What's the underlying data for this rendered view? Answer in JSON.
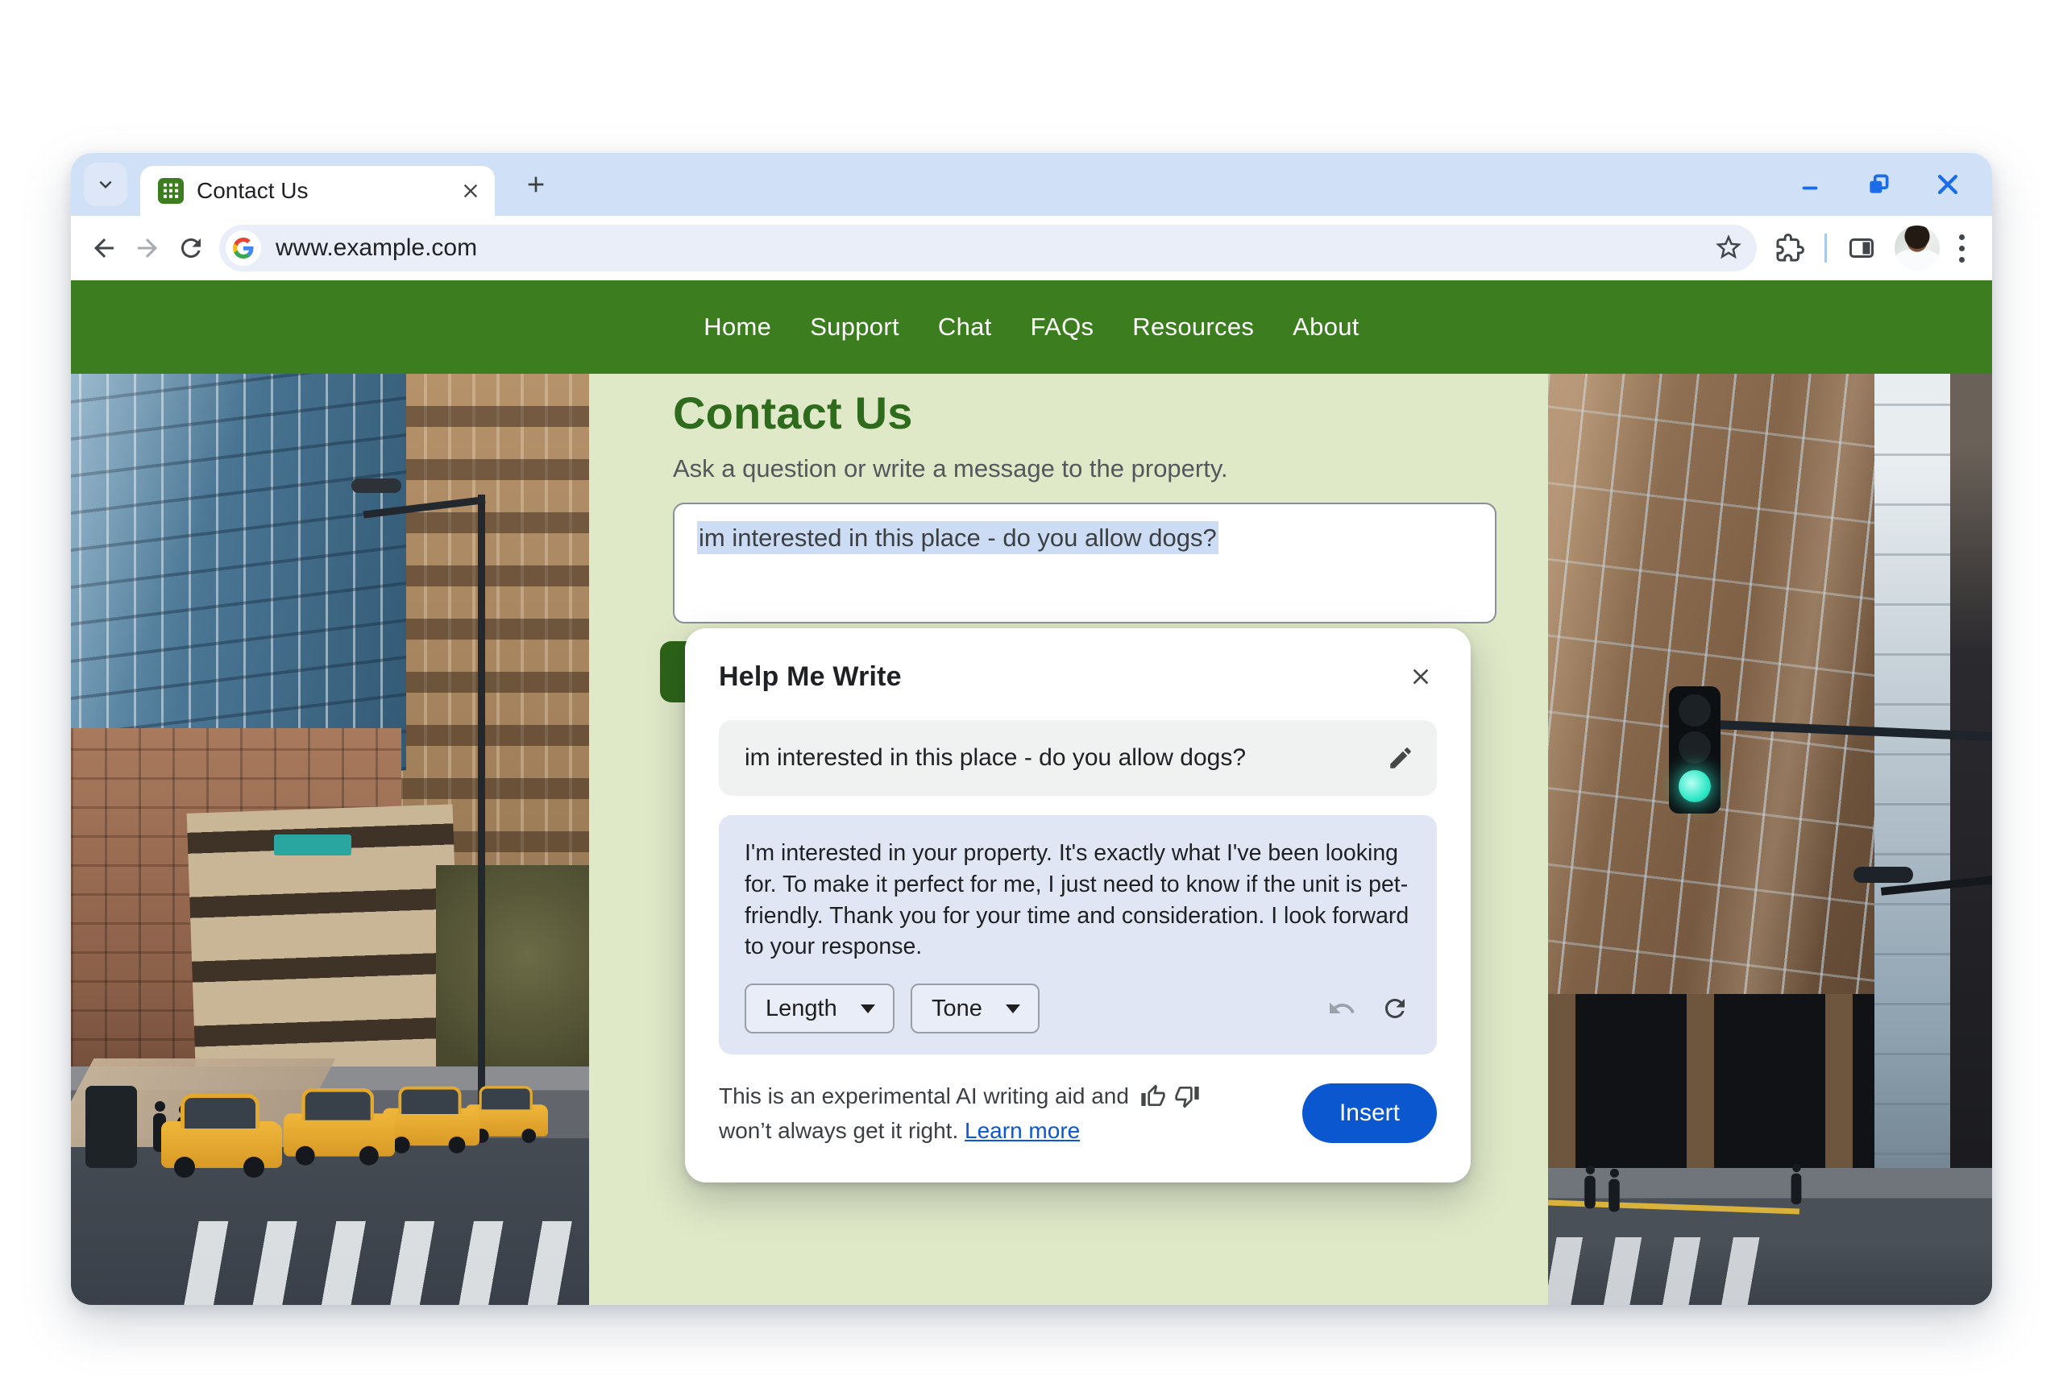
{
  "browser": {
    "tab_title": "Contact Us",
    "address": "www.example.com"
  },
  "nav": {
    "items": [
      "Home",
      "Support",
      "Chat",
      "FAQs",
      "Resources",
      "About"
    ]
  },
  "page": {
    "title": "Contact Us",
    "subtitle": "Ask a question or write a message to the property.",
    "message": "im interested in this place - do you allow dogs?"
  },
  "dialog": {
    "title": "Help Me Write",
    "prompt": "im interested in this place - do you allow dogs?",
    "suggestion": "I'm interested in your property. It's exactly what I've been looking for. To make it perfect for me, I just need to know if the unit is pet-friendly. Thank you for your time and consideration. I look forward to your response.",
    "length_label": "Length",
    "tone_label": "Tone",
    "disclaimer_line1": "This is an experimental AI writing aid and",
    "disclaimer_line2": "won’t always get it right.",
    "learn_more_label": "Learn more",
    "insert_label": "Insert"
  },
  "colors": {
    "nav_green": "#3b7d1f",
    "page_bg_green": "#dfe8c7",
    "heading_green": "#2e6b1c",
    "accent_blue": "#0b57d0",
    "selection_blue": "#cbdcf4",
    "suggestion_bg": "#e0e6f4"
  }
}
